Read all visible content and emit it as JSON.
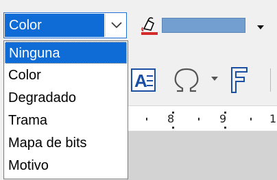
{
  "fill_style_combo": {
    "selected_value": "Color",
    "options": [
      "Ninguna",
      "Color",
      "Degradado",
      "Trama",
      "Mapa de bits",
      "Motivo"
    ],
    "highlighted_index": 0
  },
  "fill_color": {
    "swatch_color": "#729fcf"
  },
  "ruler": {
    "numbers": [
      "8",
      "9",
      "1"
    ]
  },
  "icons": {
    "fill_color": "fill-color-bucket-icon",
    "text_frame": "text-frame-icon",
    "special_character": "omega-icon",
    "fontwork": "fontwork-icon"
  },
  "colors": {
    "selection_blue": "#0f6bd6",
    "swatch": "#729fcf"
  }
}
